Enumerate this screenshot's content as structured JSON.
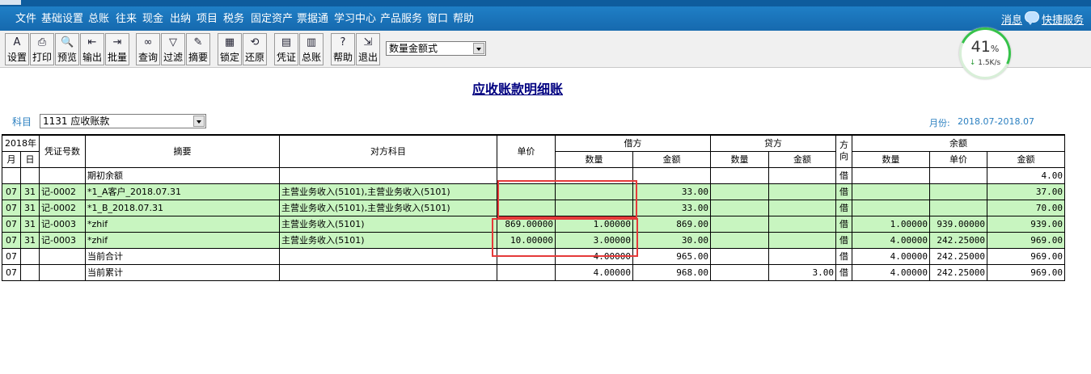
{
  "menu": {
    "items": [
      "文件",
      "基础设置",
      "总账",
      "往来",
      "现金",
      "出纳",
      "项目",
      "税务",
      "固定资产",
      "票据通",
      "学习中心",
      "产品服务",
      "窗口",
      "帮助"
    ],
    "message": "消息",
    "quick_service": "快捷服务"
  },
  "toolbar": {
    "buttons": [
      {
        "label": "设置",
        "icon": "settings-icon",
        "glyph": "A"
      },
      {
        "label": "打印",
        "icon": "printer-icon",
        "glyph": "⎙"
      },
      {
        "label": "预览",
        "icon": "preview-icon",
        "glyph": "🔍"
      },
      {
        "label": "输出",
        "icon": "export-icon",
        "glyph": "⇤"
      },
      {
        "label": "批量",
        "icon": "batch-icon",
        "glyph": "⇥"
      },
      {
        "label": "查询",
        "icon": "binoculars-icon",
        "glyph": "∞"
      },
      {
        "label": "过滤",
        "icon": "filter-icon",
        "glyph": "▽"
      },
      {
        "label": "摘要",
        "icon": "summary-icon",
        "glyph": "✎"
      },
      {
        "label": "锁定",
        "icon": "lock-icon",
        "glyph": "▦"
      },
      {
        "label": "还原",
        "icon": "restore-icon",
        "glyph": "⟲"
      },
      {
        "label": "凭证",
        "icon": "voucher-icon",
        "glyph": "▤"
      },
      {
        "label": "总账",
        "icon": "ledger-book-icon",
        "glyph": "▥"
      },
      {
        "label": "帮助",
        "icon": "help-icon",
        "glyph": "?"
      },
      {
        "label": "退出",
        "icon": "exit-icon",
        "glyph": "⇲"
      }
    ],
    "format_select": "数量金额式"
  },
  "speed_widget": {
    "percent": "41",
    "percent_unit": "%",
    "rate": "1.5K/s",
    "rate_arrow": "↓"
  },
  "report": {
    "title": "应收账款明细账",
    "subject_label": "科目",
    "subject_value": "1131 应收账款",
    "period_label": "月份:",
    "period_value": "2018.07-2018.07"
  },
  "table": {
    "headers": {
      "year": "2018年",
      "month": "月",
      "day": "日",
      "voucher_no": "凭证号数",
      "summary": "摘要",
      "counter_account": "对方科目",
      "unit_price": "单价",
      "debit": "借方",
      "credit": "贷方",
      "direction": "方向",
      "balance": "余额",
      "qty": "数量",
      "amount": "金额",
      "price": "单价"
    },
    "rows": [
      {
        "style": "white",
        "month": "",
        "day": "",
        "voucher": "",
        "summary": "期初余额",
        "counter": "",
        "unit_price": "",
        "debit_qty": "",
        "debit_amount": "",
        "credit_qty": "",
        "credit_amount": "",
        "dir": "借",
        "bal_qty": "",
        "bal_price": "",
        "bal_amount": "4.00"
      },
      {
        "style": "green",
        "month": "07",
        "day": "31",
        "voucher": "记-0002",
        "summary": "*1_A客户_2018.07.31",
        "counter": "主营业务收入(5101),主营业务收入(5101)",
        "unit_price": "",
        "debit_qty": "",
        "debit_amount": "33.00",
        "credit_qty": "",
        "credit_amount": "",
        "dir": "借",
        "bal_qty": "",
        "bal_price": "",
        "bal_amount": "37.00"
      },
      {
        "style": "green",
        "month": "07",
        "day": "31",
        "voucher": "记-0002",
        "summary": "*1_B_2018.07.31",
        "counter": "主营业务收入(5101),主营业务收入(5101)",
        "unit_price": "",
        "debit_qty": "",
        "debit_amount": "33.00",
        "credit_qty": "",
        "credit_amount": "",
        "dir": "借",
        "bal_qty": "",
        "bal_price": "",
        "bal_amount": "70.00"
      },
      {
        "style": "green",
        "month": "07",
        "day": "31",
        "voucher": "记-0003",
        "summary": "*zhif",
        "counter": "主营业务收入(5101)",
        "unit_price": "869.00000",
        "debit_qty": "1.00000",
        "debit_amount": "869.00",
        "credit_qty": "",
        "credit_amount": "",
        "dir": "借",
        "bal_qty": "1.00000",
        "bal_price": "939.00000",
        "bal_amount": "939.00"
      },
      {
        "style": "green",
        "month": "07",
        "day": "31",
        "voucher": "记-0003",
        "summary": "*zhif",
        "counter": "主营业务收入(5101)",
        "unit_price": "10.00000",
        "debit_qty": "3.00000",
        "debit_amount": "30.00",
        "credit_qty": "",
        "credit_amount": "",
        "dir": "借",
        "bal_qty": "4.00000",
        "bal_price": "242.25000",
        "bal_amount": "969.00"
      },
      {
        "style": "white",
        "month": "07",
        "day": "",
        "voucher": "",
        "summary": "当前合计",
        "counter": "",
        "unit_price": "",
        "debit_qty": "4.00000",
        "debit_amount": "965.00",
        "credit_qty": "",
        "credit_amount": "",
        "dir": "借",
        "bal_qty": "4.00000",
        "bal_price": "242.25000",
        "bal_amount": "969.00"
      },
      {
        "style": "white",
        "month": "07",
        "day": "",
        "voucher": "",
        "summary": "当前累计",
        "counter": "",
        "unit_price": "",
        "debit_qty": "4.00000",
        "debit_amount": "968.00",
        "credit_qty": "",
        "credit_amount": "3.00",
        "dir": "借",
        "bal_qty": "4.00000",
        "bal_price": "242.25000",
        "bal_amount": "969.00"
      }
    ]
  },
  "colors": {
    "menubar": "#1f7fc6",
    "row_green": "#c8f5c0",
    "title": "#000080",
    "annotation_red": "#e53a3a"
  }
}
